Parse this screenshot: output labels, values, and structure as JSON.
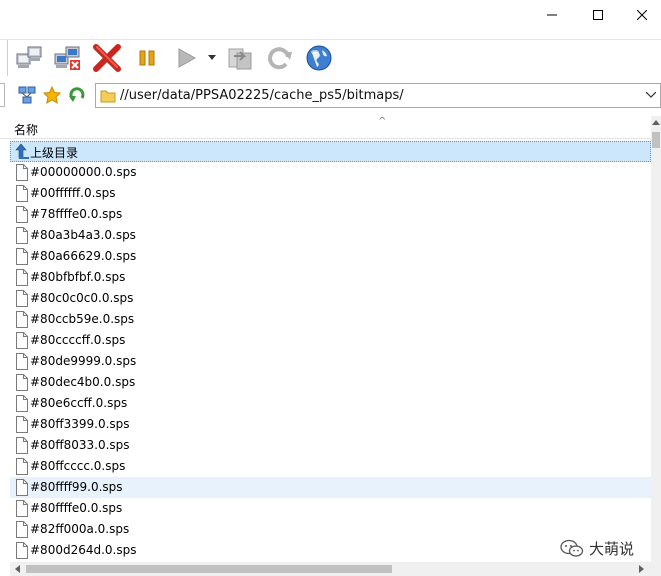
{
  "window": {
    "controls": [
      "minimize",
      "maximize",
      "close"
    ]
  },
  "toolbar": {
    "buttons": [
      {
        "icon": "connect-computers-icon"
      },
      {
        "icon": "disconnect-computers-icon"
      },
      {
        "icon": "cancel-x-icon"
      },
      {
        "icon": "pause-icon"
      },
      {
        "icon": "play-icon"
      },
      {
        "icon": "dropdown-arrow-icon"
      },
      {
        "icon": "transfer-icon"
      },
      {
        "icon": "refresh-icon"
      },
      {
        "icon": "globe-icon"
      }
    ]
  },
  "address": {
    "path": "//user/data/PPSA02225/cache_ps5/bitmaps/"
  },
  "list": {
    "column_name": "名称",
    "sort_indicator": "^",
    "parent_label": "上级目录",
    "files": [
      "#00000000.0.sps",
      "#00ffffff.0.sps",
      "#78ffffe0.0.sps",
      "#80a3b4a3.0.sps",
      "#80a66629.0.sps",
      "#80bfbfbf.0.sps",
      "#80c0c0c0.0.sps",
      "#80ccb59e.0.sps",
      "#80ccccff.0.sps",
      "#80de9999.0.sps",
      "#80dec4b0.0.sps",
      "#80e6ccff.0.sps",
      "#80ff3399.0.sps",
      "#80ff8033.0.sps",
      "#80ffcccc.0.sps",
      "#80ffff99.0.sps",
      "#80ffffe0.0.sps",
      "#82ff000a.0.sps",
      "#800d264d.0.sps"
    ],
    "hovered_file": "#80ffff99.0.sps"
  },
  "watermark": {
    "text": "大萌说"
  },
  "colors": {
    "selection": "#cce6fb",
    "hover": "#e8f2fc",
    "accent_blue": "#1f6fc5"
  }
}
